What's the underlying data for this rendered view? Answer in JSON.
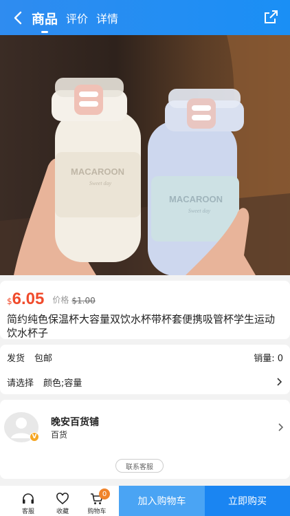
{
  "header": {
    "tabs": [
      {
        "label": "商品",
        "active": true
      },
      {
        "label": "评价",
        "active": false
      },
      {
        "label": "详情",
        "active": false
      }
    ]
  },
  "product": {
    "image": {
      "cup_label": "MACAROON",
      "cup_sub": "Sweet day"
    },
    "currency": "$",
    "price": "6.05",
    "orig_label": "价格",
    "orig_price": "$1.00",
    "title": "简约纯色保温杯大容量双饮水杯带杯套便携吸管杯学生运动饮水杯子"
  },
  "info": {
    "shipping_label": "发货",
    "shipping_value": "包邮",
    "sales_label": "销量: 0",
    "select_label": "请选择",
    "select_value": "颜色;容量"
  },
  "shop": {
    "badge": "V",
    "name": "晚安百货铺",
    "category": "百货",
    "contact_label": "联系客服"
  },
  "bottom": {
    "service_label": "客服",
    "favorite_label": "收藏",
    "cart_label": "购物车",
    "cart_count": "0",
    "add_cart_label": "加入购物车",
    "buy_now_label": "立即购买"
  },
  "colors": {
    "brand_blue": "#1a8ff5",
    "price_red": "#f04b2c",
    "badge_orange": "#f0842b"
  }
}
